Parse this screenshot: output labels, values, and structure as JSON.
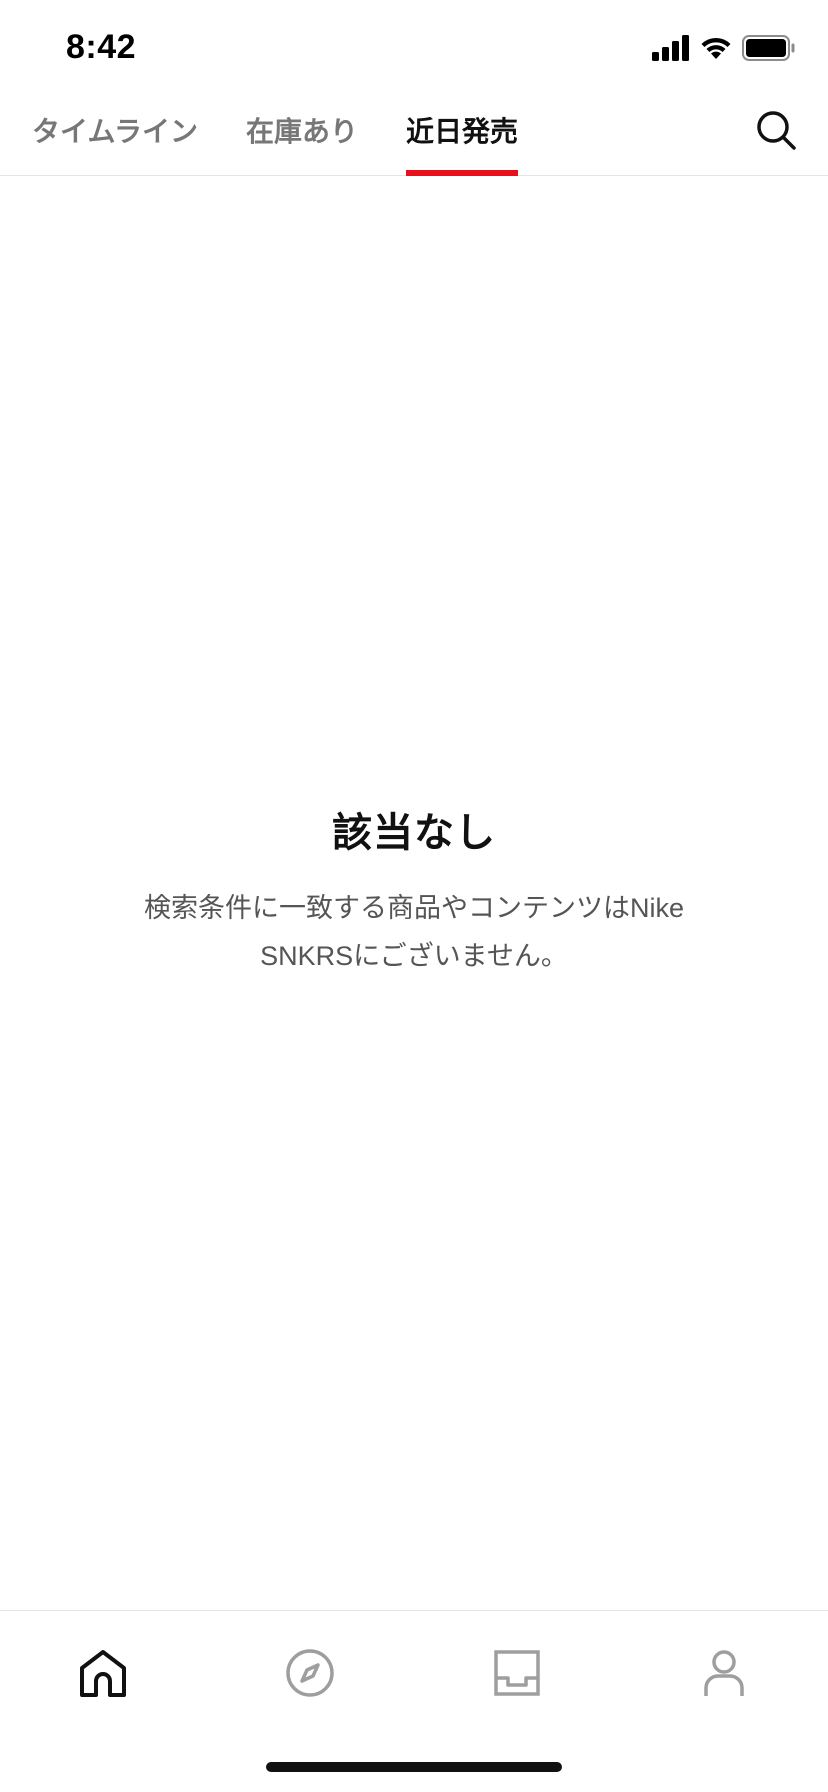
{
  "status_bar": {
    "time": "8:42",
    "icons": [
      "signal-icon",
      "wifi-icon",
      "battery-icon"
    ]
  },
  "tabs": [
    {
      "label": "タイムライン",
      "active": false
    },
    {
      "label": "在庫あり",
      "active": false
    },
    {
      "label": "近日発売",
      "active": true
    }
  ],
  "header": {
    "search_icon": "search-icon"
  },
  "empty_state": {
    "title": "該当なし",
    "message": "検索条件に一致する商品やコンテンツはNike SNKRSにございません。"
  },
  "bottom_nav": {
    "items": [
      {
        "icon": "home-icon",
        "active": true
      },
      {
        "icon": "compass-icon",
        "active": false
      },
      {
        "icon": "inbox-icon",
        "active": false
      },
      {
        "icon": "profile-icon",
        "active": false
      }
    ]
  },
  "colors": {
    "accent": "#e8101d",
    "text_primary": "#111111",
    "text_secondary": "#777777",
    "icon_inactive": "#9e9e9e"
  }
}
